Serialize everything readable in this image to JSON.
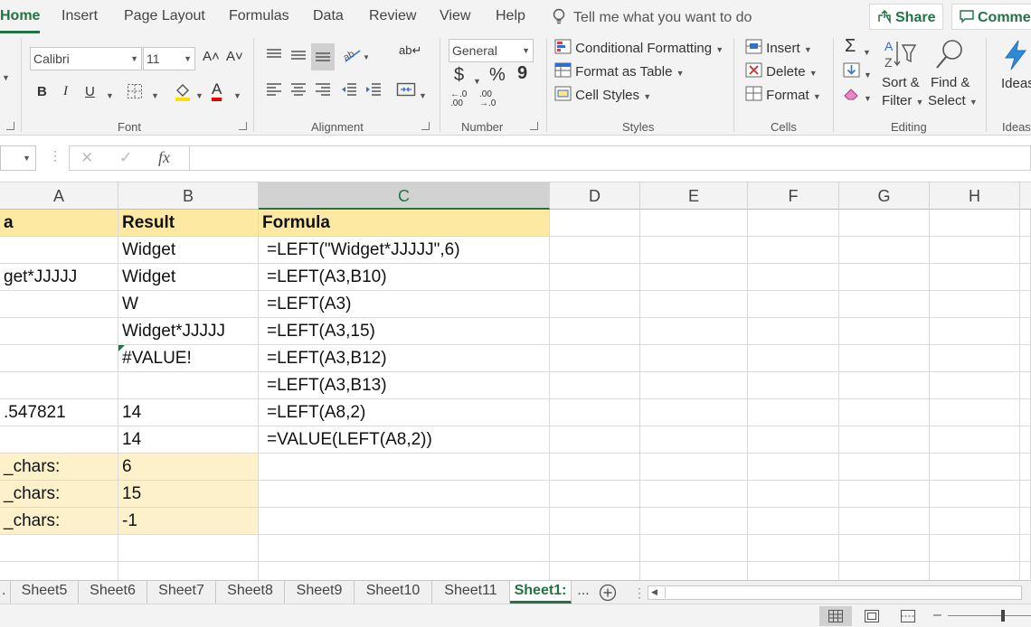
{
  "ribbon_tabs": [
    "Home",
    "Insert",
    "Page Layout",
    "Formulas",
    "Data",
    "Review",
    "View",
    "Help"
  ],
  "tell_me": "Tell me what you want to do",
  "share_label": "Share",
  "comments_label": "Comme",
  "font": {
    "name": "Calibri",
    "size": "11",
    "grow": "A˄",
    "shrink": "A˅",
    "bold": "B",
    "italic": "I",
    "underline": "U",
    "color_letter": "A",
    "group_label": "Font"
  },
  "alignment": {
    "group_label": "Alignment",
    "wrap_glyph": "ab↵"
  },
  "number": {
    "format": "General",
    "currency": "$",
    "percent": "%",
    "comma": "9",
    "inc_decimal": "←.0 .00",
    "dec_decimal": ".00 →.0",
    "group_label": "Number"
  },
  "styles": {
    "conditional_formatting": "Conditional Formatting",
    "format_as_table": "Format as Table",
    "cell_styles": "Cell Styles",
    "group_label": "Styles"
  },
  "cells": {
    "insert": "Insert",
    "delete": "Delete",
    "format": "Format",
    "group_label": "Cells"
  },
  "editing": {
    "sum_glyph": "Σ",
    "sort_filter_1": "Sort &",
    "sort_filter_2": "Filter",
    "find_select_1": "Find &",
    "find_select_2": "Select",
    "group_label": "Editing"
  },
  "ideas": {
    "label": "Ideas",
    "group_label": "Ideas"
  },
  "formula_bar": {
    "cancel_glyph": "✕",
    "enter_glyph": "✓",
    "fx": "fx",
    "content": ""
  },
  "columns": [
    "A",
    "B",
    "C",
    "D",
    "E",
    "F",
    "G",
    "H"
  ],
  "rows": [
    [
      "a",
      "Result",
      "Formula"
    ],
    [
      "",
      "Widget",
      "=LEFT(\"Widget*JJJJJ\",6)"
    ],
    [
      "get*JJJJJ",
      "Widget",
      "=LEFT(A3,B10)"
    ],
    [
      "",
      "W",
      "=LEFT(A3)"
    ],
    [
      "",
      "Widget*JJJJJ",
      "=LEFT(A3,15)"
    ],
    [
      "",
      "#VALUE!",
      "=LEFT(A3,B12)"
    ],
    [
      "",
      "",
      "=LEFT(A3,B13)"
    ],
    [
      ".547821",
      "14",
      "=LEFT(A8,2)"
    ],
    [
      "",
      "14",
      "=VALUE(LEFT(A8,2))"
    ],
    [
      "_chars:",
      "6",
      ""
    ],
    [
      "_chars:",
      "15",
      ""
    ],
    [
      "_chars:",
      "-1",
      ""
    ],
    [
      "",
      "",
      ""
    ],
    [
      "",
      "",
      ""
    ]
  ],
  "sheet_tabs": [
    "Sheet5",
    "Sheet6",
    "Sheet7",
    "Sheet8",
    "Sheet9",
    "Sheet10",
    "Sheet11",
    "Sheet1:"
  ],
  "active_sheet_index": 7,
  "sheet_more": "...",
  "sheet_prefix": ".",
  "colors": {
    "accent": "#217346",
    "header_fill": "#fde9a1",
    "highlight_fill": "#fdf1cc"
  }
}
